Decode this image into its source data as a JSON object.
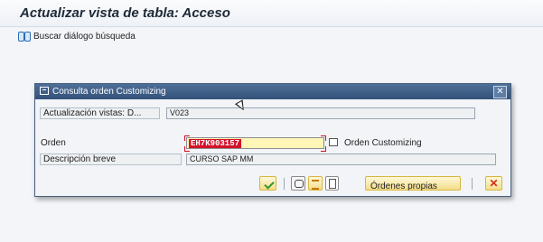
{
  "page": {
    "title": "Actualizar vista de tabla: Acceso"
  },
  "toolbar": {
    "search_label": "Buscar diálogo búsqueda"
  },
  "dialog": {
    "title": "Consulta orden Customizing",
    "close_label": "✕",
    "actualizacion_label": "Actualización vistas: D...",
    "actualizacion_value": "V023",
    "orden_label": "Orden",
    "orden_value": "EH7K903157",
    "orden_customizing_label": "Orden Customizing",
    "descripcion_label": "Descripción breve",
    "descripcion_value": "CURSO SAP MM",
    "ordenes_propias_label": "Órdenes propias"
  },
  "colors": {
    "dialog_header": "#3d5f88",
    "required_field": "#fff6b8",
    "selection": "#d4122a",
    "button": "#f4dd8a"
  },
  "icons": [
    "binoculars-icon",
    "dialog-icon",
    "close-icon",
    "f4-help-icon",
    "check-icon",
    "link-icon",
    "list-icon",
    "new-document-icon",
    "cancel-icon"
  ]
}
